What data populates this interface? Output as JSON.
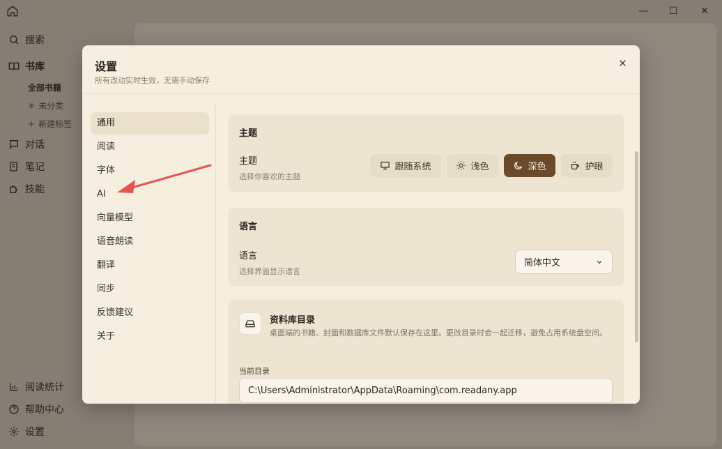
{
  "app": {
    "window_controls": {
      "minimize": "—",
      "maximize": "☐",
      "close": "✕"
    },
    "sidebar": {
      "search": "搜索",
      "library": "书库",
      "all_books": "全部书籍",
      "uncategorized": "未分类",
      "new_tag": "新建标签",
      "chat": "对话",
      "notes": "笔记",
      "skills": "技能",
      "reading_stats": "阅读统计",
      "help": "帮助中心",
      "settings": "设置"
    }
  },
  "modal": {
    "title": "设置",
    "subtitle": "所有改动实时生效，无需手动保存",
    "nav": [
      "通用",
      "阅读",
      "字体",
      "AI",
      "向量模型",
      "语音朗读",
      "翻译",
      "同步",
      "反馈建议",
      "关于"
    ],
    "active_nav": "通用",
    "theme": {
      "section_title": "主题",
      "label": "主题",
      "description": "选择你喜欢的主题",
      "options": [
        "跟随系统",
        "浅色",
        "深色",
        "护眼"
      ],
      "selected": "深色"
    },
    "language": {
      "section_title": "语言",
      "label": "语言",
      "description": "选择界面显示语言",
      "selected": "简体中文"
    },
    "library_dir": {
      "title": "资料库目录",
      "description": "桌面端的书籍、封面和数据库文件默认保存在这里。更改目录时会一起迁移，避免占用系统盘空间。",
      "current_label": "当前目录",
      "current_value": "C:\\Users\\Administrator\\AppData\\Roaming\\com.readany.app"
    }
  },
  "colors": {
    "accent": "#6b4a2a",
    "modal_bg": "#f6eedf",
    "card_bg": "#eee4d2",
    "annotation_arrow": "#e8524f"
  }
}
